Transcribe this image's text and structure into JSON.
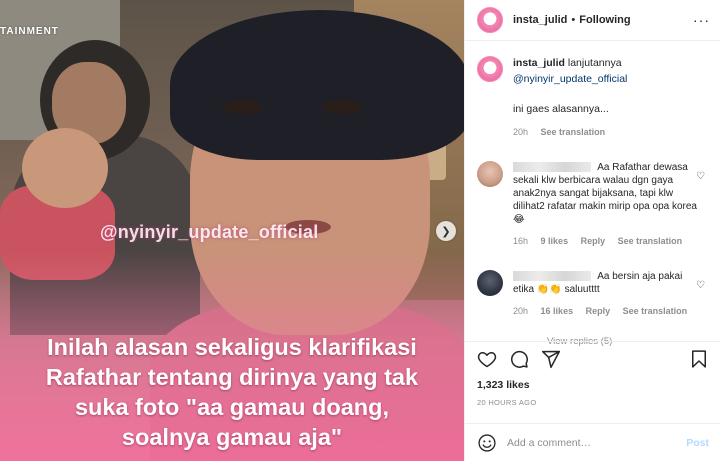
{
  "media": {
    "brand": "TAINMENT",
    "watermark": "@nyinyir_update_official",
    "caption_lines": [
      "Inilah alasan sekaligus klarifikasi",
      "Rafathar tentang dirinya yang tak",
      "suka foto \"aa gamau doang,",
      "soalnya gamau aja\""
    ],
    "next_icon": "chevron-right-icon"
  },
  "header": {
    "username": "insta_julid",
    "separator": "•",
    "follow_state": "Following",
    "more": "···"
  },
  "post": {
    "username": "insta_julid",
    "text": "lanjutannya",
    "mention": "@nyinyir_update_official",
    "text2": "ini gaes alasannya...",
    "time": "20h",
    "see_translation": "See translation"
  },
  "comments": [
    {
      "text": "Aa Rafathar dewasa sekali klw berbicara walau dgn gaya anak2nya sangat bijaksana, tapi klw dilihat2 rafatar makin mirip opa opa korea 😂",
      "time": "16h",
      "likes": "9 likes",
      "reply": "Reply",
      "see_translation": "See translation"
    },
    {
      "text": "Aa bersin aja pakai etika 👏👏 saluutttt",
      "time": "20h",
      "likes": "16 likes",
      "reply": "Reply",
      "see_translation": "See translation",
      "view_replies": "View replies (5)"
    }
  ],
  "actions": {
    "likes": "1,323 likes",
    "timestamp": "20 HOURS AGO"
  },
  "add_comment": {
    "placeholder": "Add a comment…",
    "post_label": "Post"
  },
  "colors": {
    "link": "#00376b",
    "muted": "#8e8e8e",
    "post_disabled": "#b3dbff",
    "caption_pink": "#f07aa8"
  }
}
